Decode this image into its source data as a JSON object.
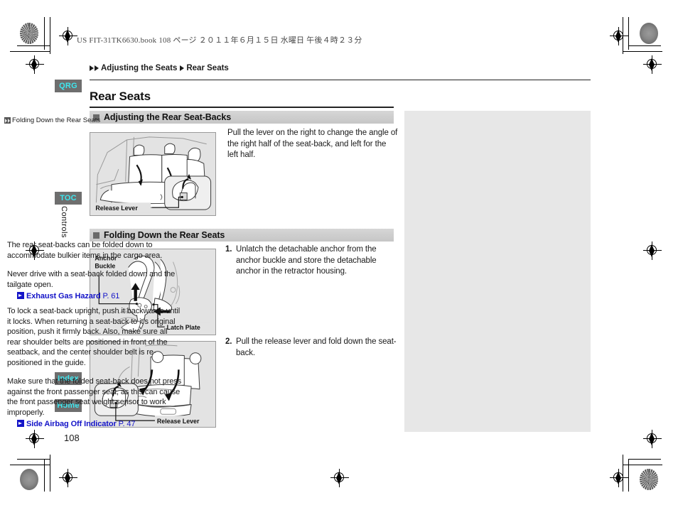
{
  "print": {
    "header_line": "US FIT-31TK6630.book   108 ページ   ２０１１年６月１５日   水曜日   午後４時２３分"
  },
  "breadcrumb": {
    "parent": "Adjusting the Seats",
    "current": "Rear Seats"
  },
  "sidebar": {
    "tabs": [
      {
        "label": "QRG",
        "name": "quick-reference-guide"
      },
      {
        "label": "TOC",
        "name": "table-of-contents"
      },
      {
        "label": "Index",
        "name": "index"
      },
      {
        "label": "Home",
        "name": "home"
      }
    ],
    "chapter_label": "Controls",
    "accent_color": "#3ee7ef",
    "tab_bg": "#6e6e6e"
  },
  "main": {
    "title": "Rear Seats",
    "sections": [
      {
        "heading": "Adjusting the Rear Seat-Backs"
      },
      {
        "heading": "Folding Down the Rear Seats"
      }
    ],
    "intro_text": "Pull the lever on the right to change the angle of the right half of the seat-back, and left for the left half.",
    "steps": [
      {
        "num": "1.",
        "text": "Unlatch the detachable anchor from the anchor buckle and store the detachable anchor in the retractor housing."
      },
      {
        "num": "2.",
        "text": "Pull the release lever and fold down the seat-back."
      }
    ],
    "figures": [
      {
        "name": "rear-seat-backs-figure",
        "callouts": [
          "Release Lever"
        ]
      },
      {
        "name": "anchor-buckle-figure",
        "callouts": [
          "Anchor",
          "Buckle",
          "Latch Plate"
        ]
      },
      {
        "name": "fold-down-seats-figure",
        "callouts": [
          "Release Lever"
        ]
      }
    ]
  },
  "note_panel": {
    "heading": "Folding Down the Rear Seats",
    "paragraphs": [
      "The rear seat-backs can be folded down to accommodate bulkier items in the cargo area.",
      "Never drive with a seat-back folded down and the tailgate open.",
      "To lock a seat-back upright, push it backwards until it locks. When returning a seat-back to it's original position, push it firmly back. Also, make sure all rear shoulder belts are positioned in front of the seatback, and the center shoulder belt is re-positioned in the guide.",
      "Make sure that the folded seat-back does not press against the front passenger seat, as this can cause the front passenger seat weight sensor to work improperly."
    ],
    "links": [
      {
        "name": "Exhaust Gas Hazard",
        "page": "P. 61"
      },
      {
        "name": "Side Airbag Off Indicator",
        "page": "P. 47"
      }
    ],
    "link_color": "#1414c8",
    "background": "#e7e7e7"
  },
  "folio": {
    "page_number": "108"
  }
}
